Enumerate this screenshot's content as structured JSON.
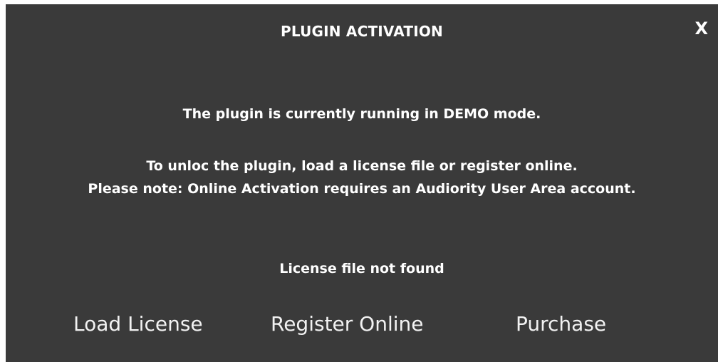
{
  "dialog": {
    "title": "PLUGIN ACTIVATION",
    "close_label": "X",
    "messages": [
      "The plugin is currently running in DEMO mode.",
      "To unloc the plugin, load a license file or register online.",
      "Please note: Online Activation requires an Audiority User Area account."
    ],
    "status": "License file not found",
    "buttons": {
      "load": "Load License",
      "register": "Register Online",
      "purchase": "Purchase"
    }
  },
  "colors": {
    "background": "#3a3a3a",
    "text": "#ffffff"
  }
}
